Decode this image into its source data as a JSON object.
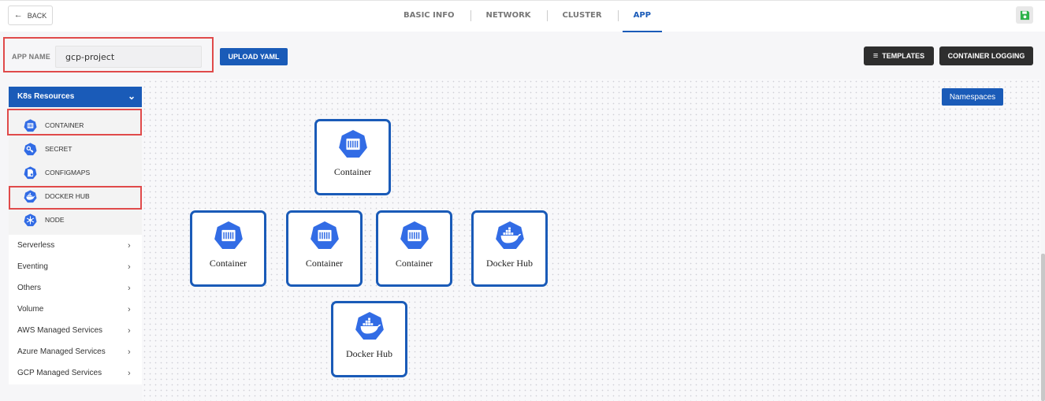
{
  "header": {
    "back_label": "BACK",
    "tabs": [
      {
        "label": "BASIC INFO",
        "active": false
      },
      {
        "label": "NETWORK",
        "active": false
      },
      {
        "label": "CLUSTER",
        "active": false
      },
      {
        "label": "APP",
        "active": true
      }
    ],
    "save_icon": "floppy-disk-icon"
  },
  "app_name": {
    "label": "APP NAME",
    "value": "gcp-project"
  },
  "toolbar": {
    "upload_label": "UPLOAD YAML",
    "templates_label": "TEMPLATES",
    "container_logging_label": "CONTAINER LOGGING"
  },
  "sidebar": {
    "k8s_title": "K8s Resources",
    "k8s_items": [
      {
        "label": "CONTAINER",
        "icon": "container-icon"
      },
      {
        "label": "SECRET",
        "icon": "key-icon"
      },
      {
        "label": "CONFIGMAPS",
        "icon": "configmap-icon"
      },
      {
        "label": "DOCKER HUB",
        "icon": "docker-icon"
      },
      {
        "label": "NODE",
        "icon": "node-icon"
      }
    ],
    "categories": [
      "Serverless",
      "Eventing",
      "Others",
      "Volume",
      "AWS Managed Services",
      "Azure Managed Services",
      "GCP Managed Services"
    ]
  },
  "canvas": {
    "namespaces_label": "Namespaces",
    "nodes": [
      {
        "label": "Container",
        "type": "container"
      },
      {
        "label": "Container",
        "type": "container"
      },
      {
        "label": "Container",
        "type": "container"
      },
      {
        "label": "Container",
        "type": "container"
      },
      {
        "label": "Docker Hub",
        "type": "docker"
      },
      {
        "label": "Docker Hub",
        "type": "docker"
      }
    ]
  },
  "colors": {
    "accent": "#1a5bb8",
    "highlight": "#e04a4a",
    "dark_button": "#2e2e2e",
    "save_green": "#2db34a"
  }
}
